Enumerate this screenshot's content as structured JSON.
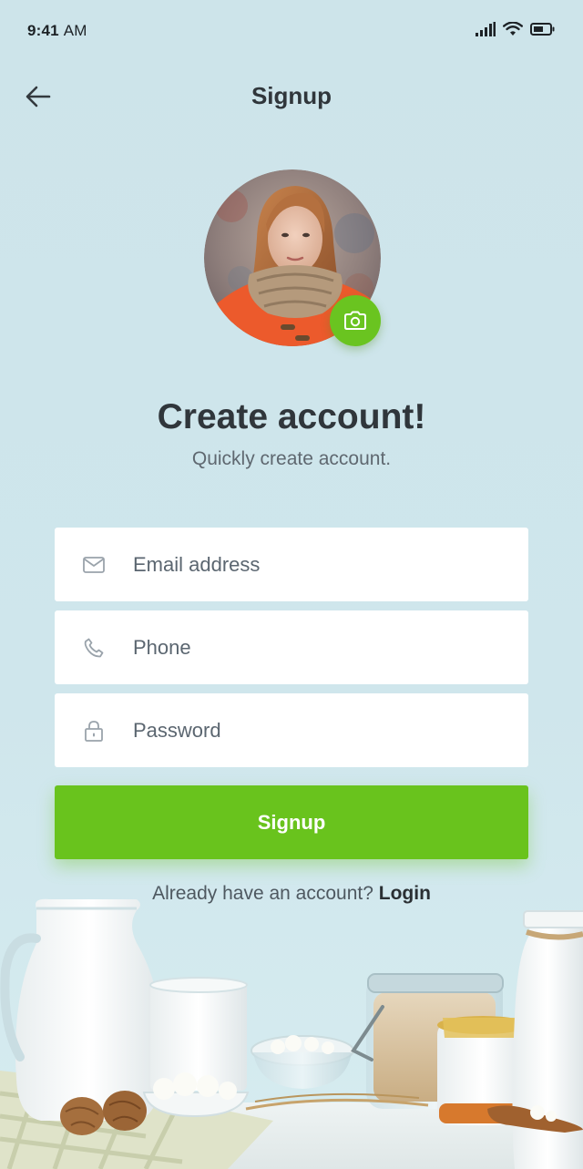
{
  "status_bar": {
    "time": "9:41",
    "ampm": "AM",
    "icons": [
      "signal-icon",
      "wifi-icon",
      "battery-icon"
    ]
  },
  "header": {
    "title": "Signup",
    "back_icon": "arrow-left-icon"
  },
  "profile": {
    "avatar": "avatar",
    "camera_icon": "camera-icon"
  },
  "intro": {
    "title": "Create account!",
    "subtitle": "Quickly create account."
  },
  "form": {
    "email": {
      "placeholder": "Email address",
      "value": "",
      "icon": "mail-icon"
    },
    "phone": {
      "placeholder": "Phone",
      "value": "",
      "icon": "phone-icon"
    },
    "password": {
      "placeholder": "Password",
      "value": "",
      "icon": "lock-icon"
    },
    "submit_label": "Signup"
  },
  "footer": {
    "prompt": "Already have an account?",
    "login_label": "Login"
  },
  "colors": {
    "background": "#cde4ea",
    "accent": "#69c31d",
    "text_dark": "#30363b",
    "text_muted": "#5f6870"
  }
}
